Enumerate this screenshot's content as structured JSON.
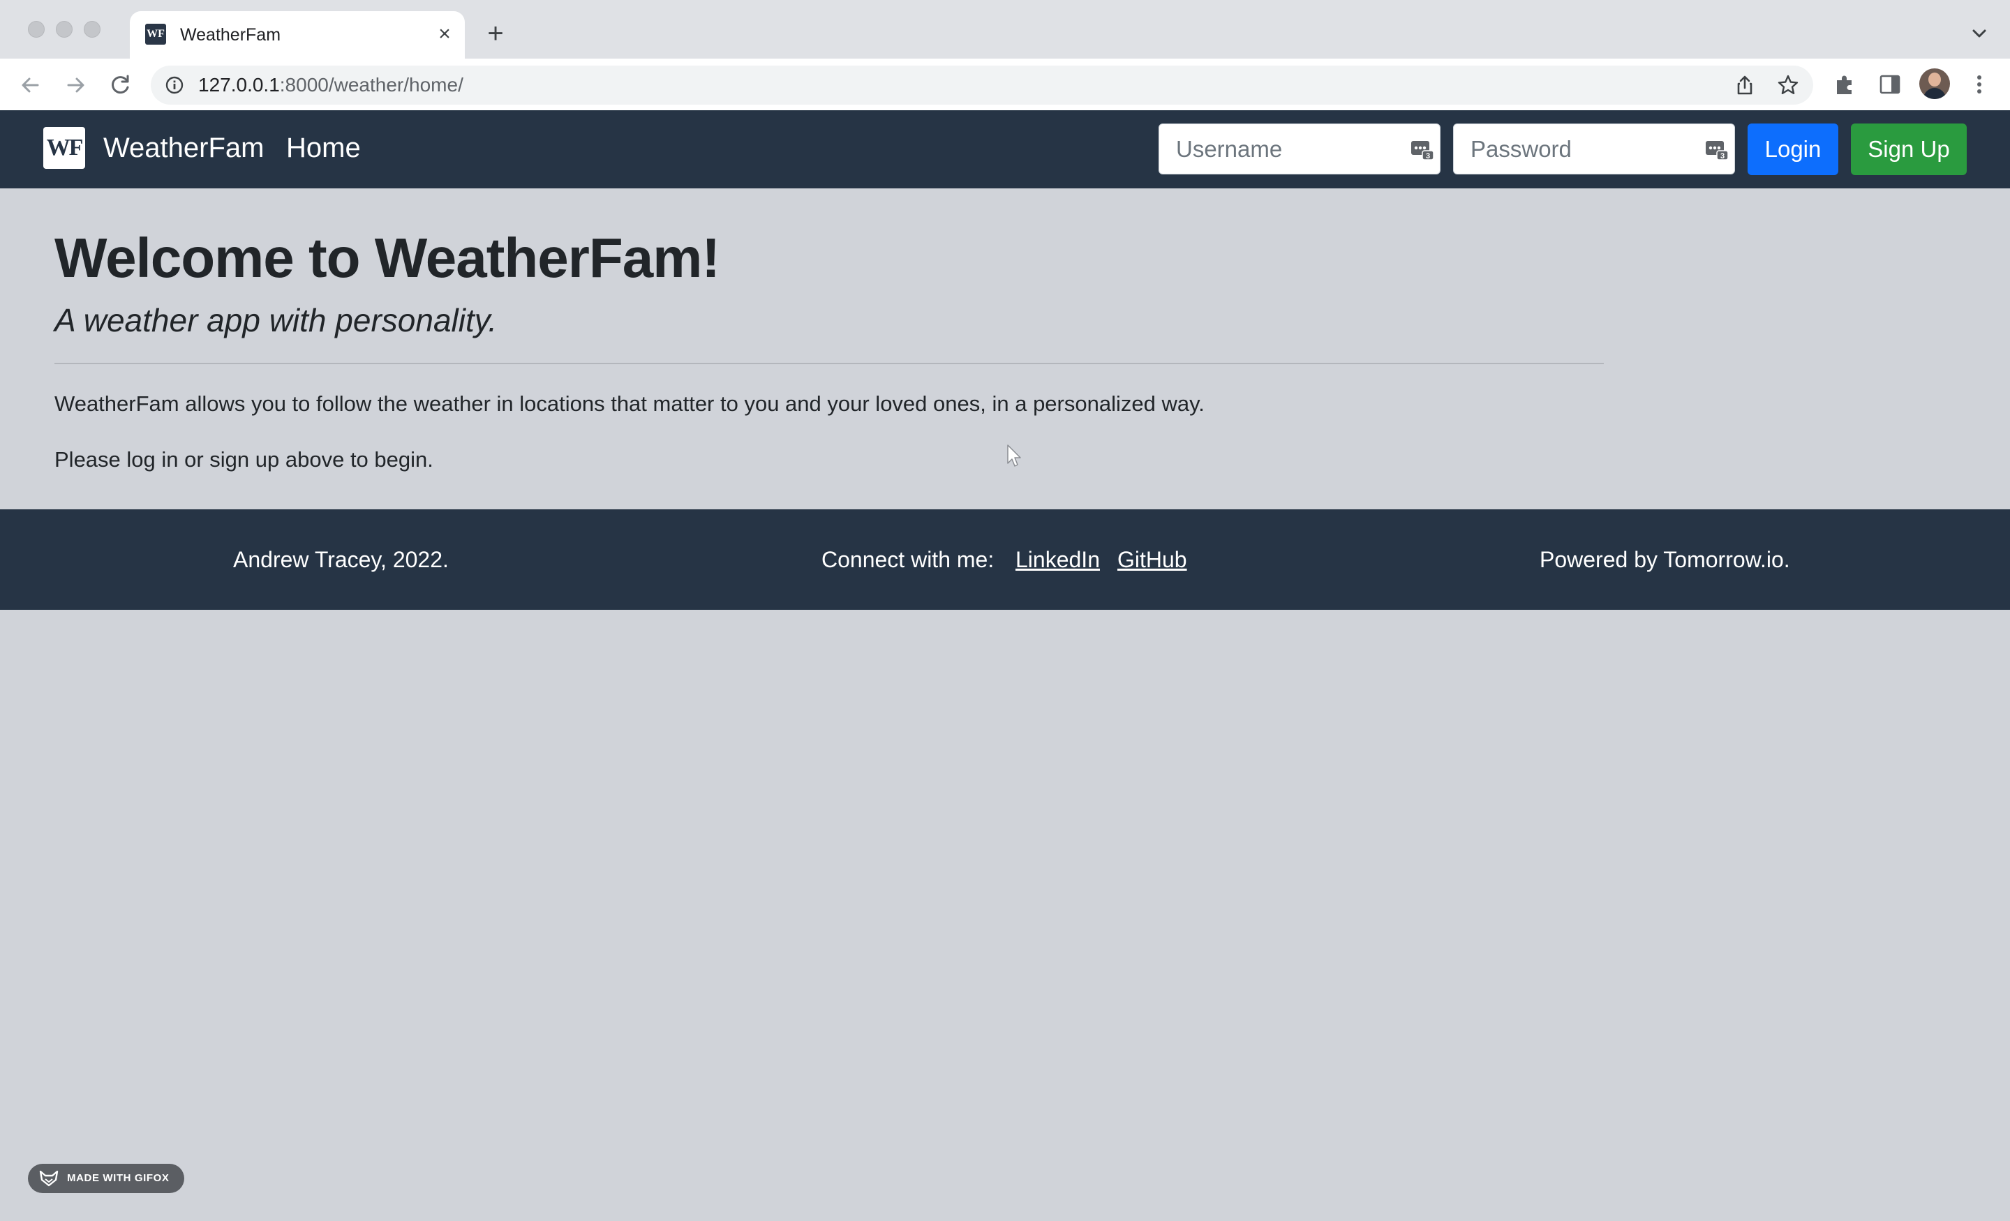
{
  "browser": {
    "tab_title": "WeatherFam",
    "favicon_text": "WF",
    "url_host": "127.0.0.1",
    "url_path": ":8000/weather/home/"
  },
  "navbar": {
    "logo_text": "WF",
    "brand": "WeatherFam",
    "home_link": "Home",
    "username_placeholder": "Username",
    "password_placeholder": "Password",
    "login_label": "Login",
    "signup_label": "Sign Up"
  },
  "main": {
    "heading": "Welcome to WeatherFam!",
    "tagline": "A weather app with personality.",
    "description": "WeatherFam allows you to follow the weather in locations that matter to you and your loved ones, in a personalized way.",
    "prompt": "Please log in or sign up above to begin."
  },
  "footer": {
    "copyright": "Andrew Tracey, 2022.",
    "connect_label": "Connect with me:",
    "linkedin": "LinkedIn",
    "github": "GitHub",
    "powered_by": "Powered by Tomorrow.io."
  },
  "badge": {
    "label": "MADE WITH GIFOX"
  },
  "colors": {
    "navbar_bg": "#263445",
    "page_bg": "#d0d3d9",
    "login_button": "#0d6efd",
    "signup_button": "#2a9b3f"
  }
}
